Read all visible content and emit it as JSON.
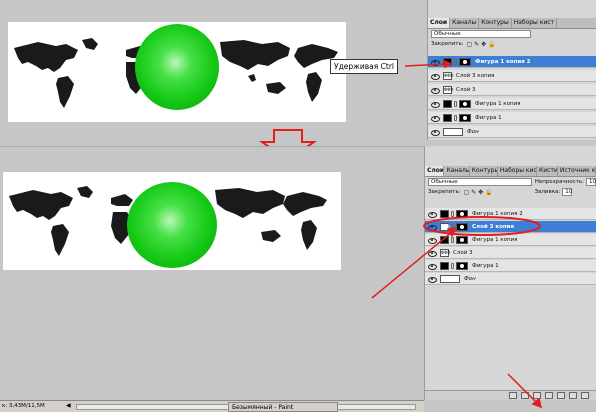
{
  "top": {
    "panel": {
      "tabs": [
        "Слои",
        "Каналы",
        "Контуры",
        "Наборы кист"
      ],
      "blend_mode": "Обычные",
      "lock_label": "Закрепить:",
      "layers": [
        {
          "name": "Фигура 1 копия 2",
          "selected": true,
          "thumb": "black"
        },
        {
          "name": "Слой 3 копия",
          "selected": false,
          "thumb": "shape"
        },
        {
          "name": "Слой 3",
          "selected": false,
          "thumb": "shape"
        },
        {
          "name": "Фигура 1 копия",
          "selected": false,
          "thumb": "black"
        },
        {
          "name": "Фигура 1",
          "selected": false,
          "thumb": "black"
        },
        {
          "name": "Фон",
          "selected": false,
          "thumb": "white"
        }
      ]
    },
    "callout": "Удерживая Ctrl"
  },
  "bottom": {
    "panel": {
      "tabs": [
        "Слои",
        "Каналы",
        "Контуры",
        "Наборы кист",
        "Кисти",
        "Источник кл"
      ],
      "blend_mode": "Обычные",
      "opacity_label": "Непрозрачность:",
      "opacity_value": "10",
      "lock_label": "Закрепить:",
      "fill_label": "Заливка:",
      "fill_value": "10",
      "layers": [
        {
          "name": "Фигура 1 копия 2",
          "selected": false,
          "thumb": "black"
        },
        {
          "name": "Слой 3 копия",
          "selected": true,
          "thumb": "shape"
        },
        {
          "name": "Фигура 1 копия",
          "selected": false,
          "thumb": "black"
        },
        {
          "name": "Слой 3",
          "selected": false,
          "thumb": "shape"
        },
        {
          "name": "Фигура 1",
          "selected": false,
          "thumb": "black"
        },
        {
          "name": "Фон",
          "selected": false,
          "thumb": "white"
        }
      ]
    }
  },
  "status": {
    "doc_size": "к: 3,43М/11,5М",
    "taskbar_item": "Безымянный - Paint"
  },
  "colors": {
    "annotation_red": "#e02020",
    "selection_blue": "#3d7fd6",
    "ball_green": "#14c814"
  }
}
